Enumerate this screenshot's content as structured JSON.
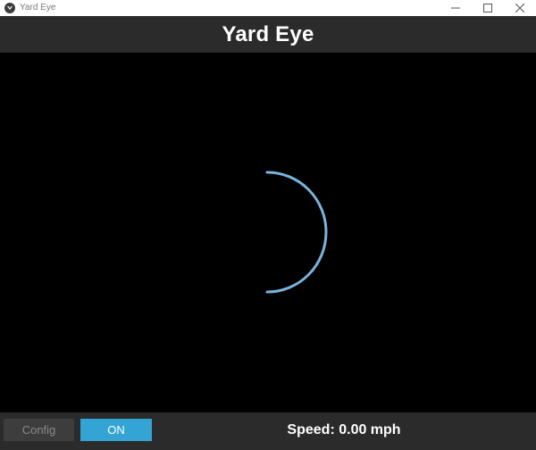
{
  "window": {
    "title": "Yard Eye",
    "controls": [
      "minimize-icon",
      "maximize-icon",
      "close-icon"
    ]
  },
  "header": {
    "title": "Yard Eye"
  },
  "viewport": {
    "indicator_icon": "arc-indicator",
    "arc_color": "#7ab4dc"
  },
  "bottombar": {
    "config_label": "Config",
    "on_label": "ON",
    "speed_prefix": "Speed: ",
    "speed_value": "0.00",
    "speed_unit": " mph"
  },
  "colors": {
    "header_bg": "#2b2b2b",
    "accent": "#33a4d4",
    "disabled_bg": "#3d3d3d",
    "disabled_text": "#8a8a8a"
  }
}
